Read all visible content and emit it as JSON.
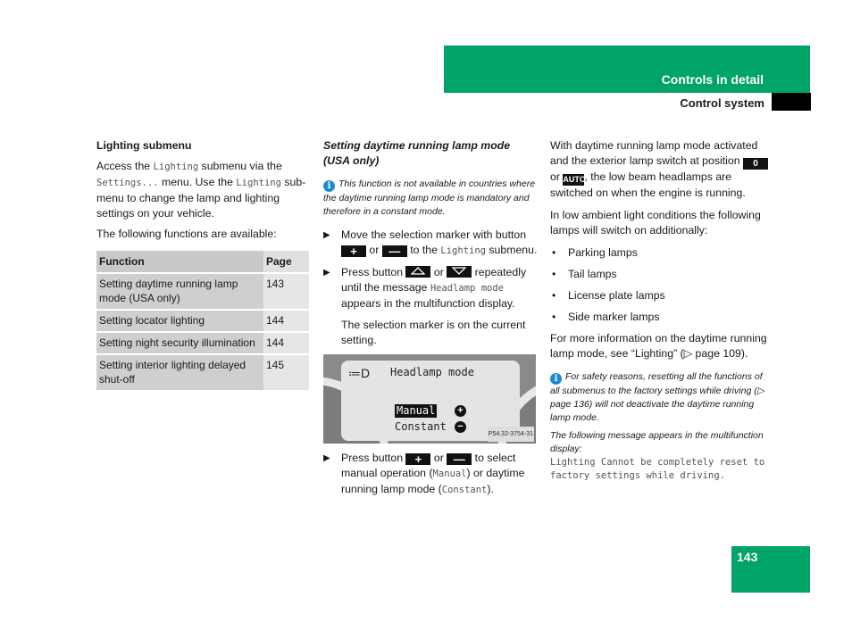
{
  "header": {
    "section_title": "Controls in detail",
    "subsection_title": "Control system",
    "accent_color": "#00a466"
  },
  "col1": {
    "heading": "Lighting submenu",
    "p1_a": "Access the ",
    "p1_mono1": "Lighting",
    "p1_b": " submenu via the ",
    "p1_mono2": "Settings...",
    "p1_c": " menu. Use the ",
    "p1_mono3": "Lighting",
    "p1_d": " sub-menu to change the lamp and lighting settings on your vehicle.",
    "p2": "The following functions are available:",
    "table": {
      "headers": [
        "Function",
        "Page"
      ],
      "rows": [
        {
          "function": "Setting daytime running lamp mode (USA only)",
          "page": "143"
        },
        {
          "function": "Setting locator lighting",
          "page": "144"
        },
        {
          "function": "Setting night security illumination",
          "page": "144"
        },
        {
          "function": "Setting interior lighting delayed shut-off",
          "page": "145"
        }
      ]
    }
  },
  "col2": {
    "heading": "Setting daytime running lamp mode (USA only)",
    "note": "This function is not available in countries where the daytime running lamp mode is mandatory and therefore in a constant mode.",
    "step1_a": "Move the selection marker with button ",
    "step1_or": " or ",
    "step1_b": " to the ",
    "step1_mono": "Lighting",
    "step1_c": " submenu.",
    "step2_a": "Press button ",
    "step2_or": " or ",
    "step2_b": " repeatedly until the message ",
    "step2_mono": "Headlamp mode",
    "step2_c": " appears in the multifunction display.",
    "step2_result": "The selection marker is on the current setting.",
    "display": {
      "title": "Headlamp mode",
      "option_selected": "Manual",
      "option_other": "Constant",
      "image_code": "P54.32-3754-31"
    },
    "step3_a": "Press button ",
    "step3_or": " or ",
    "step3_b": " to select manual operation (",
    "step3_mono1": "Manual",
    "step3_c": ") or daytime running lamp mode (",
    "step3_mono2": "Constant",
    "step3_d": ")."
  },
  "col3": {
    "p1_a": "With daytime running lamp mode activated and the exterior lamp switch at position ",
    "switch_0": "0",
    "p1_or": " or ",
    "switch_auto": "AUTO",
    "p1_b": ", the low beam headlamps are switched on when the engine is running.",
    "p2": "In low ambient light conditions the following lamps will switch on additionally:",
    "bullets": [
      "Parking lamps",
      "Tail lamps",
      "License plate lamps",
      "Side marker lamps"
    ],
    "p3": "For more information on the daytime running lamp mode, see “Lighting” (▷ page 109).",
    "note": "For safety reasons, resetting all the functions of all submenus to the factory settings while driving (▷ page 136) will not deactivate the daytime running lamp mode.",
    "note2": "The following message appears in the multifunction display:",
    "message": "Lighting Cannot be completely reset to factory settings while driving."
  },
  "footer": {
    "page_number": "143"
  }
}
